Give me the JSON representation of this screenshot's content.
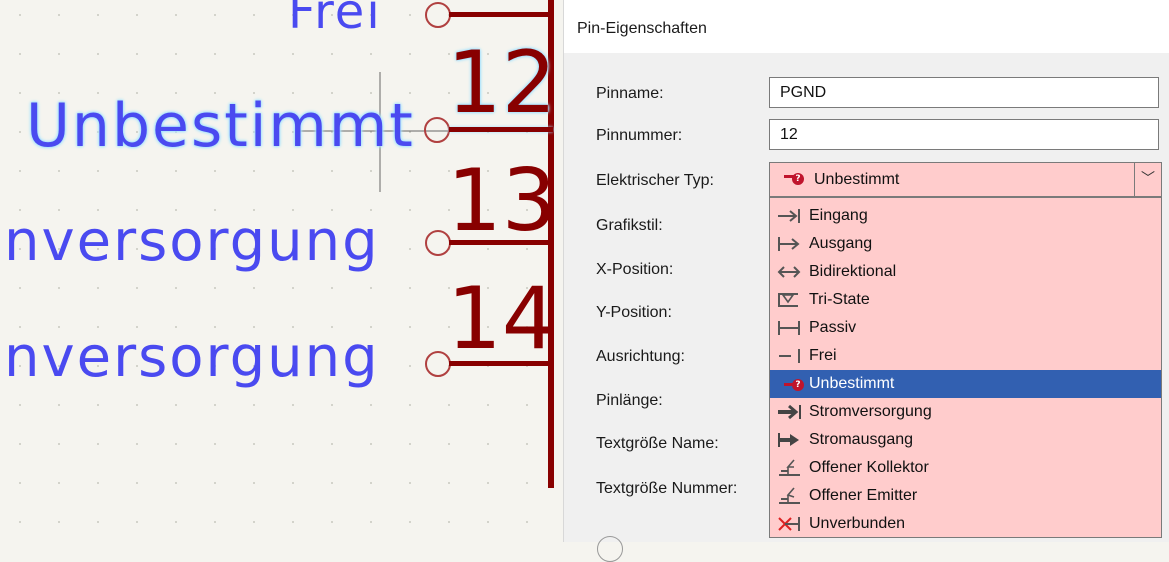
{
  "canvas": {
    "pins": [
      {
        "name": "Frei",
        "number": ""
      },
      {
        "name": "Unbestimmt",
        "number": "12"
      },
      {
        "name": "nversorgung",
        "number": "13"
      },
      {
        "name": "nversorgung",
        "number": "14"
      }
    ]
  },
  "dialog": {
    "title": "Pin-Eigenschaften",
    "labels": {
      "pin_name": "Pinname:",
      "pin_number": "Pinnummer:",
      "electrical_type": "Elektrischer Typ:",
      "graphic_style": "Grafikstil:",
      "x_position": "X-Position:",
      "y_position": "Y-Position:",
      "orientation": "Ausrichtung:",
      "pin_length": "Pinlänge:",
      "name_text_size": "Textgröße Name:",
      "number_text_size": "Textgröße Nummer:"
    },
    "pin_name_value": "PGND",
    "pin_number_value": "12",
    "electrical_type_selected": "Unbestimmt",
    "electrical_type_options": [
      {
        "label": "Eingang",
        "icon": "input-pin-icon"
      },
      {
        "label": "Ausgang",
        "icon": "output-pin-icon"
      },
      {
        "label": "Bidirektional",
        "icon": "bidirectional-pin-icon"
      },
      {
        "label": "Tri-State",
        "icon": "tristate-pin-icon"
      },
      {
        "label": "Passiv",
        "icon": "passive-pin-icon"
      },
      {
        "label": "Frei",
        "icon": "free-pin-icon"
      },
      {
        "label": "Unbestimmt",
        "icon": "unspecified-pin-icon"
      },
      {
        "label": "Stromversorgung",
        "icon": "power-input-pin-icon"
      },
      {
        "label": "Stromausgang",
        "icon": "power-output-pin-icon"
      },
      {
        "label": "Offener Kollektor",
        "icon": "open-collector-pin-icon"
      },
      {
        "label": "Offener Emitter",
        "icon": "open-emitter-pin-icon"
      },
      {
        "label": "Unverbunden",
        "icon": "not-connected-pin-icon"
      }
    ],
    "colors": {
      "invalid_field_bg": "#ffcccc",
      "selection_bg": "#3260b1",
      "pin_line": "#880000",
      "pin_name_text": "#4a4af0"
    }
  }
}
